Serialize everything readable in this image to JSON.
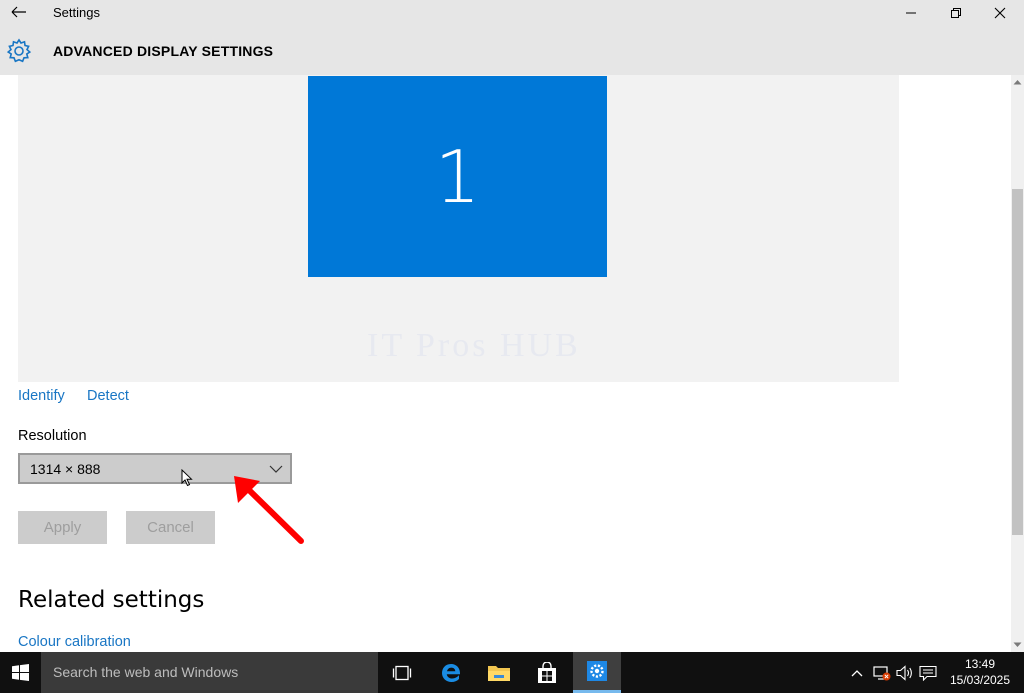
{
  "window": {
    "app_title": "Settings",
    "icons": {
      "back": "back-arrow-icon",
      "minimize": "minimize-icon",
      "maximize": "restore-icon",
      "close": "close-icon"
    }
  },
  "header": {
    "title": "ADVANCED DISPLAY SETTINGS",
    "icon": "gear-icon"
  },
  "display": {
    "monitor_number": "1",
    "watermark": "IT Pros HUB"
  },
  "links": {
    "identify": "Identify",
    "detect": "Detect"
  },
  "resolution": {
    "label": "Resolution",
    "value": "1314 × 888"
  },
  "buttons": {
    "apply": "Apply",
    "cancel": "Cancel"
  },
  "related": {
    "title": "Related settings",
    "colour_calibration": "Colour calibration"
  },
  "taskbar": {
    "search_placeholder": "Search the web and Windows",
    "time": "13:49",
    "date": "15/03/2025",
    "apps": [
      "start-icon",
      "task-view-icon",
      "edge-icon",
      "file-explorer-icon",
      "store-icon",
      "settings-icon"
    ]
  },
  "colors": {
    "accent": "#0078d7",
    "link": "#1976c4",
    "annotation_arrow": "#ff0000"
  }
}
